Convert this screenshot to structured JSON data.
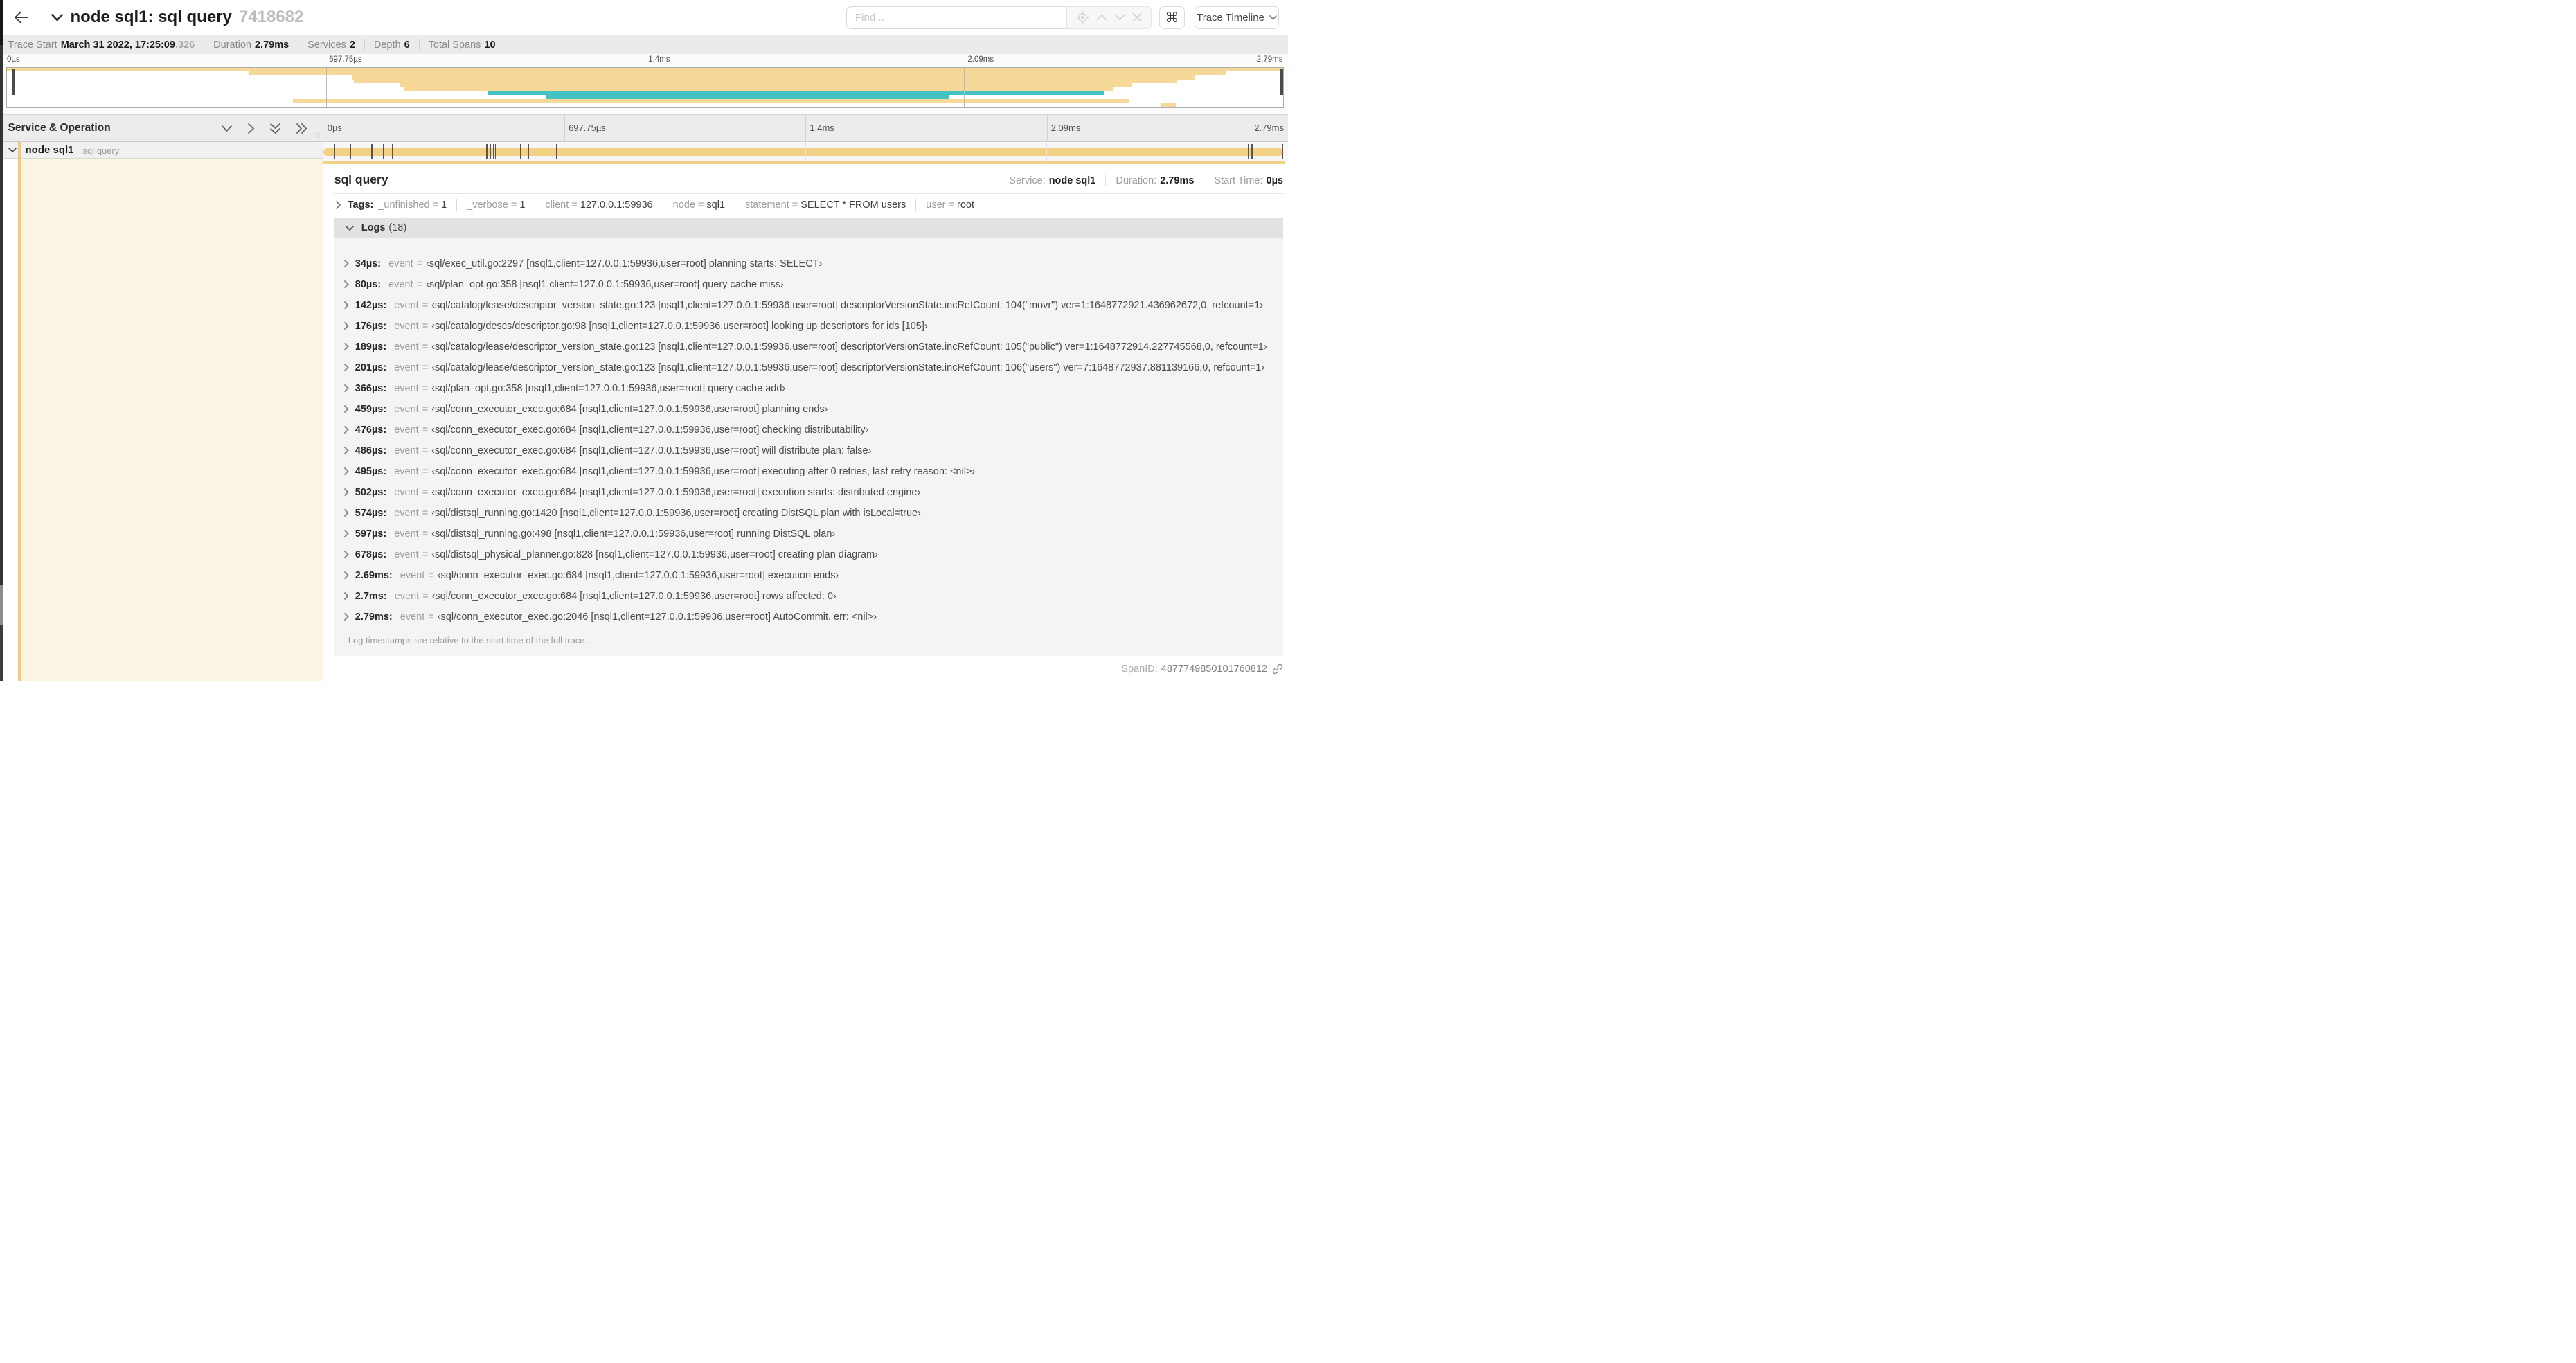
{
  "header": {
    "back_icon": "left-arrow",
    "title": "node sql1: sql query",
    "trace_id": "7418682",
    "find_placeholder": "Find...",
    "shortcut_icon": "⌘",
    "view_dropdown": "Trace Timeline"
  },
  "summary": {
    "items": [
      {
        "label": "Trace Start",
        "value": "March 31 2022, 17:25:09",
        "suffix": ".326"
      },
      {
        "label": "Duration",
        "value": "2.79ms"
      },
      {
        "label": "Services",
        "value": "2"
      },
      {
        "label": "Depth",
        "value": "6"
      },
      {
        "label": "Total Spans",
        "value": "10"
      }
    ]
  },
  "colors": {
    "span_tan": "#f3d184",
    "span_teal": "#45c2c4",
    "accent_strip": "#efca7f",
    "detail_left_bg": "#fcf5e3"
  },
  "minimap": {
    "ticks": [
      "0µs",
      "697.75µs",
      "1.4ms",
      "2.09ms",
      "2.79ms"
    ],
    "spans": [
      {
        "start": 0.0,
        "end": 1.0,
        "color": "tan"
      },
      {
        "start": 0.19,
        "end": 0.955,
        "color": "tan"
      },
      {
        "start": 0.271,
        "end": 0.931,
        "color": "tan"
      },
      {
        "start": 0.272,
        "end": 0.917,
        "color": "tan"
      },
      {
        "start": 0.308,
        "end": 0.882,
        "color": "tan"
      },
      {
        "start": 0.311,
        "end": 0.867,
        "color": "tan"
      },
      {
        "start": 0.377,
        "end": 0.86,
        "color": "teal"
      },
      {
        "start": 0.423,
        "end": 0.738,
        "color": "teal"
      },
      {
        "start": 0.224,
        "end": 0.879,
        "color": "tan"
      },
      {
        "start": 0.905,
        "end": 0.916,
        "color": "tan"
      }
    ]
  },
  "timeline": {
    "left_header": "Service & Operation",
    "ticks": [
      "0µs",
      "697.75µs",
      "1.4ms",
      "2.09ms",
      "2.79ms"
    ]
  },
  "row": {
    "service": "node sql1",
    "operation": "sql query",
    "bar": {
      "start": 0.0,
      "end": 1.0,
      "log_ticks": [
        0.0122,
        0.0287,
        0.0509,
        0.0631,
        0.0677,
        0.072,
        0.1312,
        0.1645,
        0.1706,
        0.1742,
        0.1774,
        0.1799,
        0.2057,
        0.214,
        0.243,
        0.9642,
        0.9677,
        0.9995
      ]
    }
  },
  "detail": {
    "title": "sql query",
    "meta": [
      {
        "label": "Service:",
        "value": "node sql1"
      },
      {
        "label": "Duration:",
        "value": "2.79ms"
      },
      {
        "label": "Start Time:",
        "value": "0µs"
      }
    ],
    "tags_label": "Tags:",
    "tags": [
      {
        "key": "_unfinished",
        "value": "1"
      },
      {
        "key": "_verbose",
        "value": "1"
      },
      {
        "key": "client",
        "value": "127.0.0.1:59936"
      },
      {
        "key": "node",
        "value": "sql1"
      },
      {
        "key": "statement",
        "value": "SELECT * FROM users"
      },
      {
        "key": "user",
        "value": "root"
      }
    ],
    "logs_label": "Logs",
    "logs_count": "(18)",
    "log_field": "event",
    "logs": [
      {
        "time": "34µs:",
        "value": "‹sql/exec_util.go:2297 [nsql1,client=127.0.0.1:59936,user=root] planning starts: SELECT›"
      },
      {
        "time": "80µs:",
        "value": "‹sql/plan_opt.go:358 [nsql1,client=127.0.0.1:59936,user=root] query cache miss›"
      },
      {
        "time": "142µs:",
        "value": "‹sql/catalog/lease/descriptor_version_state.go:123 [nsql1,client=127.0.0.1:59936,user=root] descriptorVersionState.incRefCount: 104(\"movr\") ver=1:1648772921.436962672,0, refcount=1›"
      },
      {
        "time": "176µs:",
        "value": "‹sql/catalog/descs/descriptor.go:98 [nsql1,client=127.0.0.1:59936,user=root] looking up descriptors for ids [105]›"
      },
      {
        "time": "189µs:",
        "value": "‹sql/catalog/lease/descriptor_version_state.go:123 [nsql1,client=127.0.0.1:59936,user=root] descriptorVersionState.incRefCount: 105(\"public\") ver=1:1648772914.227745568,0, refcount=1›"
      },
      {
        "time": "201µs:",
        "value": "‹sql/catalog/lease/descriptor_version_state.go:123 [nsql1,client=127.0.0.1:59936,user=root] descriptorVersionState.incRefCount: 106(\"users\") ver=7:1648772937.881139166,0, refcount=1›"
      },
      {
        "time": "366µs:",
        "value": "‹sql/plan_opt.go:358 [nsql1,client=127.0.0.1:59936,user=root] query cache add›"
      },
      {
        "time": "459µs:",
        "value": "‹sql/conn_executor_exec.go:684 [nsql1,client=127.0.0.1:59936,user=root] planning ends›"
      },
      {
        "time": "476µs:",
        "value": "‹sql/conn_executor_exec.go:684 [nsql1,client=127.0.0.1:59936,user=root] checking distributability›"
      },
      {
        "time": "486µs:",
        "value": "‹sql/conn_executor_exec.go:684 [nsql1,client=127.0.0.1:59936,user=root] will distribute plan: false›"
      },
      {
        "time": "495µs:",
        "value": "‹sql/conn_executor_exec.go:684 [nsql1,client=127.0.0.1:59936,user=root] executing after 0 retries, last retry reason: <nil>›"
      },
      {
        "time": "502µs:",
        "value": "‹sql/conn_executor_exec.go:684 [nsql1,client=127.0.0.1:59936,user=root] execution starts: distributed engine›"
      },
      {
        "time": "574µs:",
        "value": "‹sql/distsql_running.go:1420 [nsql1,client=127.0.0.1:59936,user=root] creating DistSQL plan with isLocal=true›"
      },
      {
        "time": "597µs:",
        "value": "‹sql/distsql_running.go:498 [nsql1,client=127.0.0.1:59936,user=root] running DistSQL plan›"
      },
      {
        "time": "678µs:",
        "value": "‹sql/distsql_physical_planner.go:828 [nsql1,client=127.0.0.1:59936,user=root] creating plan diagram›"
      },
      {
        "time": "2.69ms:",
        "value": "‹sql/conn_executor_exec.go:684 [nsql1,client=127.0.0.1:59936,user=root] execution ends›"
      },
      {
        "time": "2.7ms:",
        "value": "‹sql/conn_executor_exec.go:684 [nsql1,client=127.0.0.1:59936,user=root] rows affected: 0›"
      },
      {
        "time": "2.79ms:",
        "value": "‹sql/conn_executor_exec.go:2046 [nsql1,client=127.0.0.1:59936,user=root] AutoCommit. err: <nil>›"
      }
    ],
    "note": "Log timestamps are relative to the start time of the full trace.",
    "span_id_label": "SpanID:",
    "span_id": "4877749850101760812"
  }
}
